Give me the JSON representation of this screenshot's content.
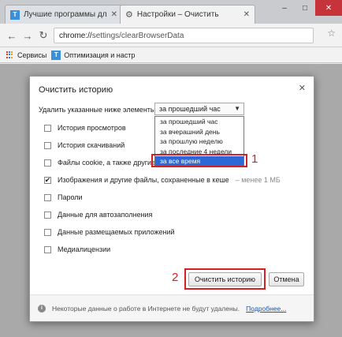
{
  "tabs": [
    {
      "title": "Лучшие программы для",
      "icon": "favicon-t",
      "icon_text": "T"
    },
    {
      "title": "Настройки – Очистить",
      "icon": "gear-icon"
    }
  ],
  "window_controls": {
    "minimize": "–",
    "maximize": "□",
    "close": "✕"
  },
  "address_bar": {
    "protocol": "chrome://",
    "path": "settings/clearBrowserData"
  },
  "bookmarks": [
    {
      "label": "Сервисы",
      "icon": "apps-icon"
    },
    {
      "label": "Оптимизация и настр",
      "icon": "favicon-t",
      "icon_text": "T"
    }
  ],
  "dialog": {
    "title": "Очистить историю",
    "range_label": "Удалить указанные ниже элементы",
    "selected_range": "за прошедший час",
    "dropdown_options": [
      "за прошедший час",
      "за вчерашний день",
      "за прошлую неделю",
      "за последние 4 недели",
      "за все время"
    ],
    "highlighted_option": "за все время",
    "options": [
      {
        "label": "История просмотров",
        "checked": false
      },
      {
        "label": "История скачиваний",
        "checked": false
      },
      {
        "label": "Файлы cookie, а также другие",
        "checked": false
      },
      {
        "label": "Изображения и другие файлы, сохраненные в кеше",
        "note": "– менее 1 МБ",
        "checked": true
      },
      {
        "label": "Пароли",
        "checked": false
      },
      {
        "label": "Данные для автозаполнения",
        "checked": false
      },
      {
        "label": "Данные размещаемых приложений",
        "checked": false
      },
      {
        "label": "Медиалицензии",
        "checked": false
      }
    ],
    "clear_button": "Очистить историю",
    "cancel_button": "Отмена",
    "footer_text": "Некоторые данные о работе в Интернете не будут удалены.",
    "footer_link": "Подробнее..."
  },
  "annotations": {
    "marker1": "1",
    "marker2": "2"
  },
  "colors": {
    "accent": "#d32027",
    "selection": "#2c68d6"
  }
}
